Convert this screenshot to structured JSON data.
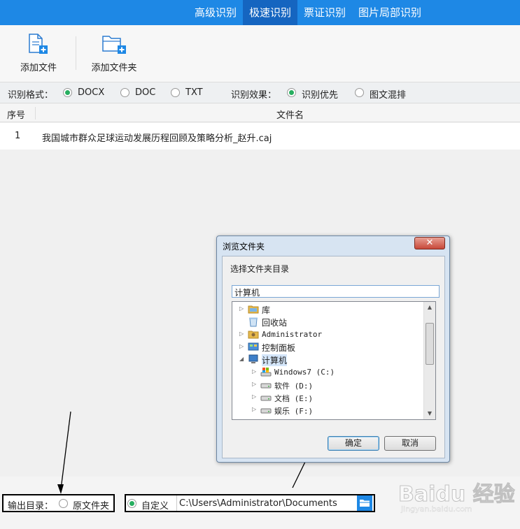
{
  "topbar": {
    "tabs": [
      {
        "label": "高级识别",
        "active": false
      },
      {
        "label": "极速识别",
        "active": true
      },
      {
        "label": "票证识别",
        "active": false
      },
      {
        "label": "图片局部识别",
        "active": false
      }
    ],
    "accent_color": "#1e88e5",
    "active_color": "#1565c0"
  },
  "toolbar": {
    "add_file_label": "添加文件",
    "add_file_icon": "add-file-icon",
    "add_folder_label": "添加文件夹",
    "add_folder_icon": "add-folder-icon"
  },
  "options": {
    "format_label": "识别格式：",
    "formats": [
      "DOCX",
      "DOC",
      "TXT"
    ],
    "format_selected": "DOCX",
    "effect_label": "识别效果：",
    "effects": [
      "识别优先",
      "图文混排"
    ],
    "effect_selected": "识别优先"
  },
  "table": {
    "headers": [
      "序号",
      "文件名"
    ],
    "rows": [
      {
        "index": "1",
        "name": "我国城市群众足球运动发展历程回顾及策略分析_赵升.caj"
      }
    ]
  },
  "output": {
    "label": "输出目录：",
    "option_original": "原文件夹",
    "option_custom": "自定义",
    "selected": "自定义",
    "path": "C:\\Users\\Administrator\\Documents",
    "browse_icon": "folder-icon"
  },
  "dialog": {
    "title": "浏览文件夹",
    "close": "✕",
    "prompt": "选择文件夹目录",
    "field_value": "计算机",
    "tree": [
      {
        "label": "库",
        "icon": "library-icon"
      },
      {
        "label": "回收站",
        "icon": "recycle-bin-icon"
      },
      {
        "label": "Administrator",
        "icon": "user-folder-icon"
      },
      {
        "label": "控制面板",
        "icon": "control-panel-icon"
      },
      {
        "label": "计算机",
        "icon": "computer-icon",
        "selected": true
      },
      {
        "label": "Windows7 (C:)",
        "icon": "system-drive-icon"
      },
      {
        "label": "软件 (D:)",
        "icon": "drive-icon"
      },
      {
        "label": "文档 (E:)",
        "icon": "drive-icon"
      },
      {
        "label": "娱乐 (F:)",
        "icon": "drive-icon"
      }
    ],
    "ok": "确定",
    "cancel": "取消"
  },
  "watermark": {
    "logo": "Baidu 经验",
    "url": "jingyan.baidu.com"
  }
}
